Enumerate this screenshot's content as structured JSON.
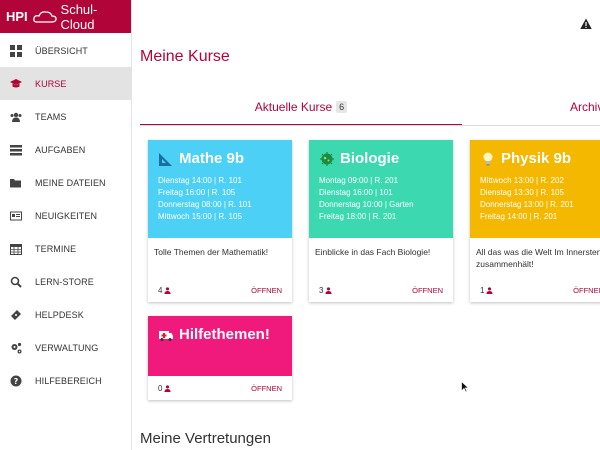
{
  "brand": {
    "short": "HPI",
    "title": "Schul-Cloud"
  },
  "sidebar": {
    "items": [
      {
        "label": "ÜBERSICHT",
        "icon": "dashboard-icon"
      },
      {
        "label": "KURSE",
        "icon": "graduation-cap-icon",
        "active": true
      },
      {
        "label": "TEAMS",
        "icon": "users-icon"
      },
      {
        "label": "AUFGABEN",
        "icon": "tasks-icon"
      },
      {
        "label": "MEINE DATEIEN",
        "icon": "folder-icon"
      },
      {
        "label": "NEUIGKEITEN",
        "icon": "newspaper-icon"
      },
      {
        "label": "TERMINE",
        "icon": "calendar-icon"
      },
      {
        "label": "LERN-STORE",
        "icon": "search-icon"
      },
      {
        "label": "HELPDESK",
        "icon": "ticket-icon"
      },
      {
        "label": "VERWALTUNG",
        "icon": "cogs-icon"
      },
      {
        "label": "HILFEBEREICH",
        "icon": "question-icon"
      }
    ]
  },
  "main": {
    "title": "Meine Kurse",
    "tabs": {
      "current_label": "Aktuelle Kurse",
      "current_count": "6",
      "archive_label": "Archiv"
    },
    "section2": "Meine Vertretungen"
  },
  "colors": {
    "brand": "#b10438",
    "math": "#4cd0f5",
    "bio": "#3cd9b0",
    "physik": "#f4b800",
    "help": "#f0197c"
  },
  "courses": [
    {
      "name": "Mathe 9b",
      "schedule": [
        "Dienstag 14:00 | R. 101",
        "Freitag 16:00 | R. 105",
        "Donnerstag 08:00 | R. 101",
        "Mittwoch 15:00 | R. 105"
      ],
      "description": "Tolle Themen der Mathematik!",
      "members": "4",
      "open": "ÖFFNEN"
    },
    {
      "name": "Biologie",
      "schedule": [
        "Montag 09:00 | R. 201",
        "Dienstag 16:00 | 101",
        "Donnerstag 10:00 | Garten",
        "Freitag 18:00 | R. 201"
      ],
      "description": "Einblicke in das Fach Biologie!",
      "members": "3",
      "open": "ÖFFNEN"
    },
    {
      "name": "Physik 9b",
      "schedule": [
        "Mittwoch 13:00 | R. 202",
        "Dienstag 13:30 | R. 105",
        "Donnerstag 13:00 | R. 201",
        "Freitag 14:00 | R. 201"
      ],
      "description": "All das was die Welt Im Innersten zusammenhält!",
      "members": "1",
      "open": "ÖFFNEN"
    },
    {
      "name": "Hilfethemen!",
      "schedule": [],
      "description": "",
      "members": "0",
      "open": "ÖFFNEN"
    }
  ]
}
